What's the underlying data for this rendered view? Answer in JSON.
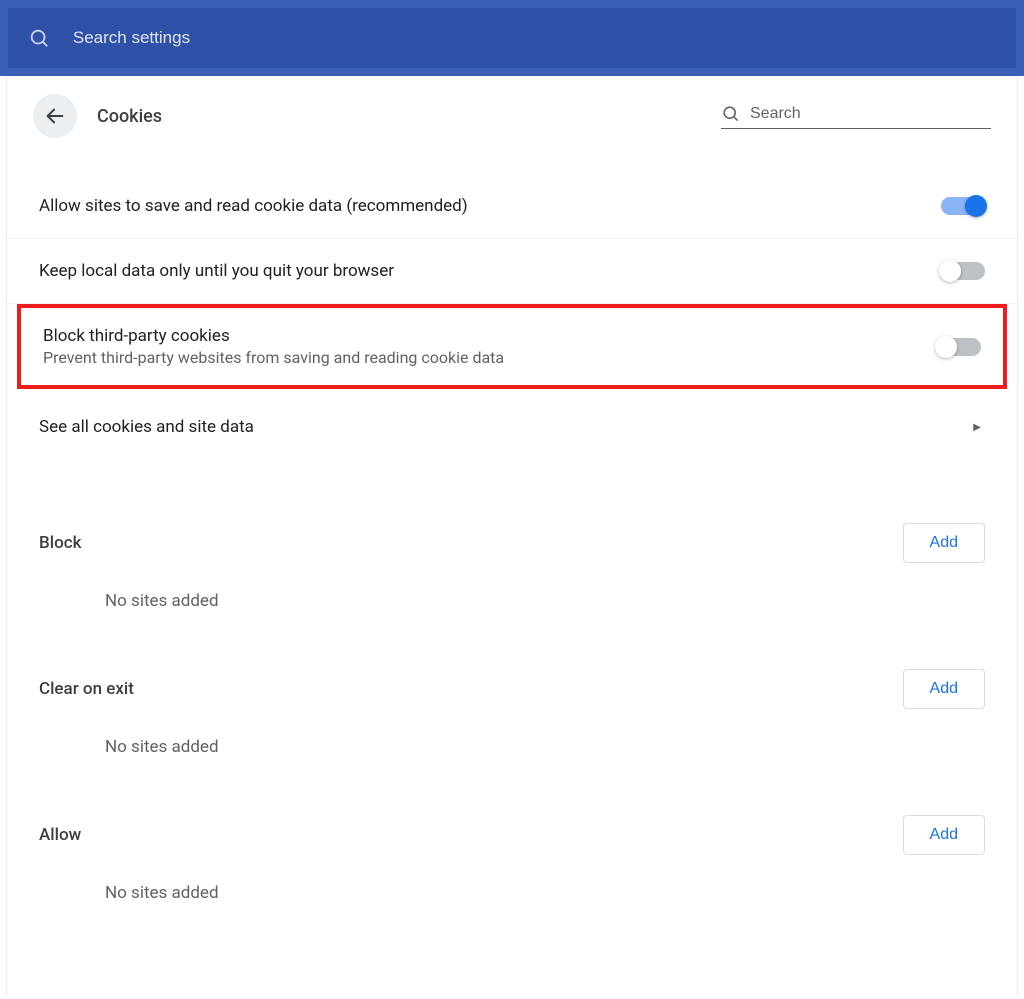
{
  "top": {
    "search_placeholder": "Search settings"
  },
  "header": {
    "title": "Cookies",
    "search_placeholder": "Search"
  },
  "settings": {
    "allow_cookies": {
      "title": "Allow sites to save and read cookie data (recommended)",
      "on": true
    },
    "keep_local_until_quit": {
      "title": "Keep local data only until you quit your browser",
      "on": false
    },
    "block_third_party": {
      "title": "Block third-party cookies",
      "desc": "Prevent third-party websites from saving and reading cookie data",
      "on": false
    },
    "see_all": {
      "title": "See all cookies and site data"
    }
  },
  "buttons": {
    "add": "Add"
  },
  "sections": {
    "block": {
      "label": "Block",
      "empty": "No sites added"
    },
    "clear_on_exit": {
      "label": "Clear on exit",
      "empty": "No sites added"
    },
    "allow": {
      "label": "Allow",
      "empty": "No sites added"
    }
  }
}
